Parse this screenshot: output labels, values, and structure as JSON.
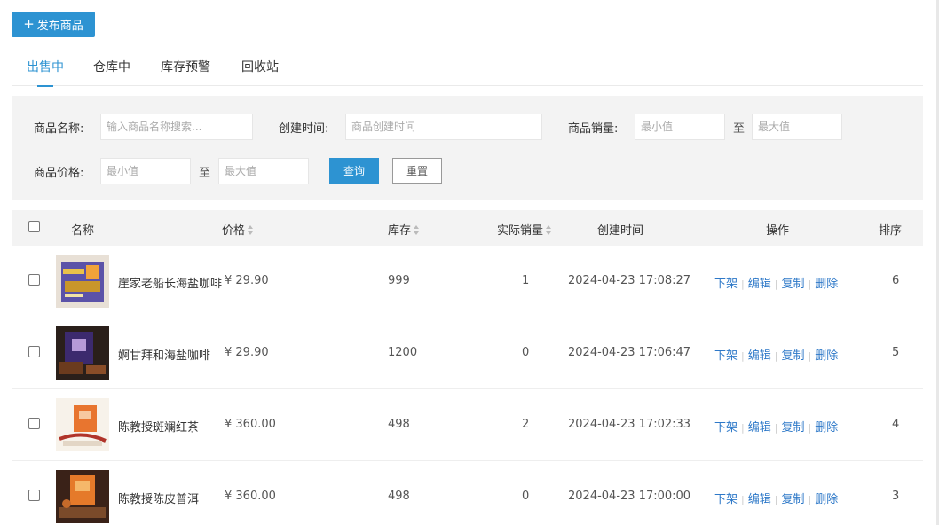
{
  "publish_button": {
    "label": "发布商品",
    "plus": "+"
  },
  "tabs": [
    {
      "label": "出售中",
      "active": true
    },
    {
      "label": "仓库中",
      "active": false
    },
    {
      "label": "库存预警",
      "active": false
    },
    {
      "label": "回收站",
      "active": false
    }
  ],
  "filter": {
    "name_label": "商品名称:",
    "name_placeholder": "输入商品名称搜索...",
    "time_label": "创建时间:",
    "time_placeholder": "商品创建时间",
    "sales_label": "商品销量:",
    "sales_min_placeholder": "最小值",
    "sales_to": "至",
    "sales_max_placeholder": "最大值",
    "price_label": "商品价格:",
    "price_min_placeholder": "最小值",
    "price_to": "至",
    "price_max_placeholder": "最大值",
    "query_label": "查询",
    "reset_label": "重置"
  },
  "table": {
    "headers": {
      "name": "名称",
      "price": "价格",
      "stock": "库存",
      "sales": "实际销量",
      "created": "创建时间",
      "actions": "操作",
      "sort": "排序"
    },
    "action_labels": {
      "off_shelf": "下架",
      "edit": "编辑",
      "copy": "复制",
      "delete": "删除"
    },
    "rows": [
      {
        "name": "崖家老船长海盐咖啡",
        "price": "¥ 29.90",
        "stock": "999",
        "sales": "1",
        "created": "2024-04-23 17:08:27",
        "sort": "6",
        "thumb": "coffee-box-blue"
      },
      {
        "name": "婀甘拜和海盐咖啡",
        "price": "¥ 29.90",
        "stock": "1200",
        "sales": "0",
        "created": "2024-04-23 17:06:47",
        "sort": "5",
        "thumb": "coffee-box-purple"
      },
      {
        "name": "陈教授斑斓红茶",
        "price": "¥ 360.00",
        "stock": "498",
        "sales": "2",
        "created": "2024-04-23 17:02:33",
        "sort": "4",
        "thumb": "tea-bag-orange"
      },
      {
        "name": "陈教授陈皮普洱",
        "price": "¥ 360.00",
        "stock": "498",
        "sales": "0",
        "created": "2024-04-23 17:00:00",
        "sort": "3",
        "thumb": "tea-box-orange"
      }
    ]
  },
  "colors": {
    "accent": "#2d93d2",
    "link": "#2d78c8",
    "panel_bg": "#f3f3f3"
  }
}
